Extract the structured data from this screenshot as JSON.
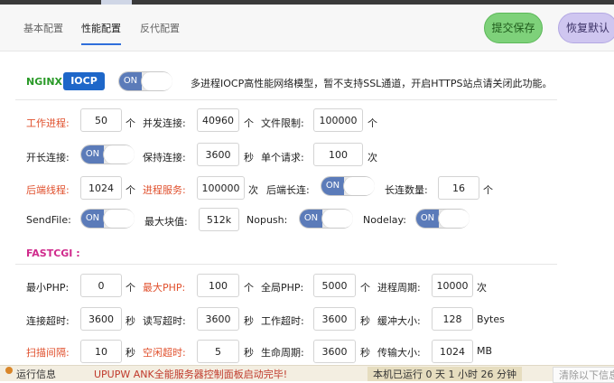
{
  "tabs": [
    {
      "label": "基本配置"
    },
    {
      "label": "性能配置"
    },
    {
      "label": "反代配置"
    }
  ],
  "actions": {
    "save_label": "提交保存",
    "restore_label": "恢复默认"
  },
  "nginx": {
    "title": "NGINX :",
    "iocp_label": "IOCP",
    "toggle_label": "ON",
    "description": "多进程IOCP高性能网络模型，暂不支持SSL通道，开启HTTPS站点请关闭此功能。"
  },
  "params": {
    "worker_processes": {
      "label": "工作进程:",
      "value": "50",
      "unit": "个"
    },
    "concurrent_conn": {
      "label": "并发连接:",
      "value": "40960",
      "unit": "个"
    },
    "file_limit": {
      "label": "文件限制:",
      "value": "100000",
      "unit": "个"
    },
    "keepalive_on": {
      "label": "开长连接:",
      "toggle": "ON"
    },
    "keepalive_timeout": {
      "label": "保持连接:",
      "value": "3600",
      "unit": "秒"
    },
    "single_request": {
      "label": "单个请求:",
      "value": "100",
      "unit": "次"
    },
    "backend_threads": {
      "label": "后端线程:",
      "value": "1024",
      "unit": "个"
    },
    "proc_service": {
      "label": "进程服务:",
      "value": "100000",
      "unit": "次"
    },
    "backend_longconn": {
      "label": "后端长连:",
      "toggle": "ON"
    },
    "longconn_count": {
      "label": "长连数量:",
      "value": "16",
      "unit": "个"
    },
    "sendfile": {
      "label": "SendFile:",
      "toggle": "ON"
    },
    "max_block": {
      "label": "最大块值:",
      "value": "512k"
    },
    "nopush": {
      "label": "Nopush:",
      "toggle": "ON"
    },
    "nodelay": {
      "label": "Nodelay:",
      "toggle": "ON"
    }
  },
  "fastcgi": {
    "title": "FASTCGI :",
    "min_php": {
      "label": "最小PHP:",
      "value": "0",
      "unit": "个"
    },
    "max_php": {
      "label": "最大PHP:",
      "value": "100",
      "unit": "个"
    },
    "global_php": {
      "label": "全局PHP:",
      "value": "5000",
      "unit": "个"
    },
    "proc_period": {
      "label": "进程周期:",
      "value": "10000",
      "unit": "次"
    },
    "conn_timeout": {
      "label": "连接超时:",
      "value": "3600",
      "unit": "秒"
    },
    "rw_timeout": {
      "label": "读写超时:",
      "value": "3600",
      "unit": "秒"
    },
    "work_timeout": {
      "label": "工作超时:",
      "value": "3600",
      "unit": "秒"
    },
    "buffer_size": {
      "label": "缓冲大小:",
      "value": "128",
      "unit": "Bytes"
    },
    "scan_interval": {
      "label": "扫描间隔:",
      "value": "10",
      "unit": "秒"
    },
    "idle_timeout": {
      "label": "空闲超时:",
      "value": "5",
      "unit": "秒"
    },
    "life_period": {
      "label": "生命周期:",
      "value": "3600",
      "unit": "秒"
    },
    "transfer_size": {
      "label": "传输大小:",
      "value": "1024",
      "unit": "MB"
    }
  },
  "status": {
    "info_label": "运行信息",
    "message": "UPUPW ANK全能服务器控制面板启动完毕!",
    "uptime": "本机已运行 0 天 1 小时 26 分钟",
    "clear_label": "清除以下信息"
  },
  "colors": {
    "accent": "#2f6fdb",
    "toggle_on": "#5b7bb9",
    "highlight_red": "#e0502d",
    "fastcgi_title": "#d02a8c",
    "nginx_title": "#2a9a28"
  }
}
